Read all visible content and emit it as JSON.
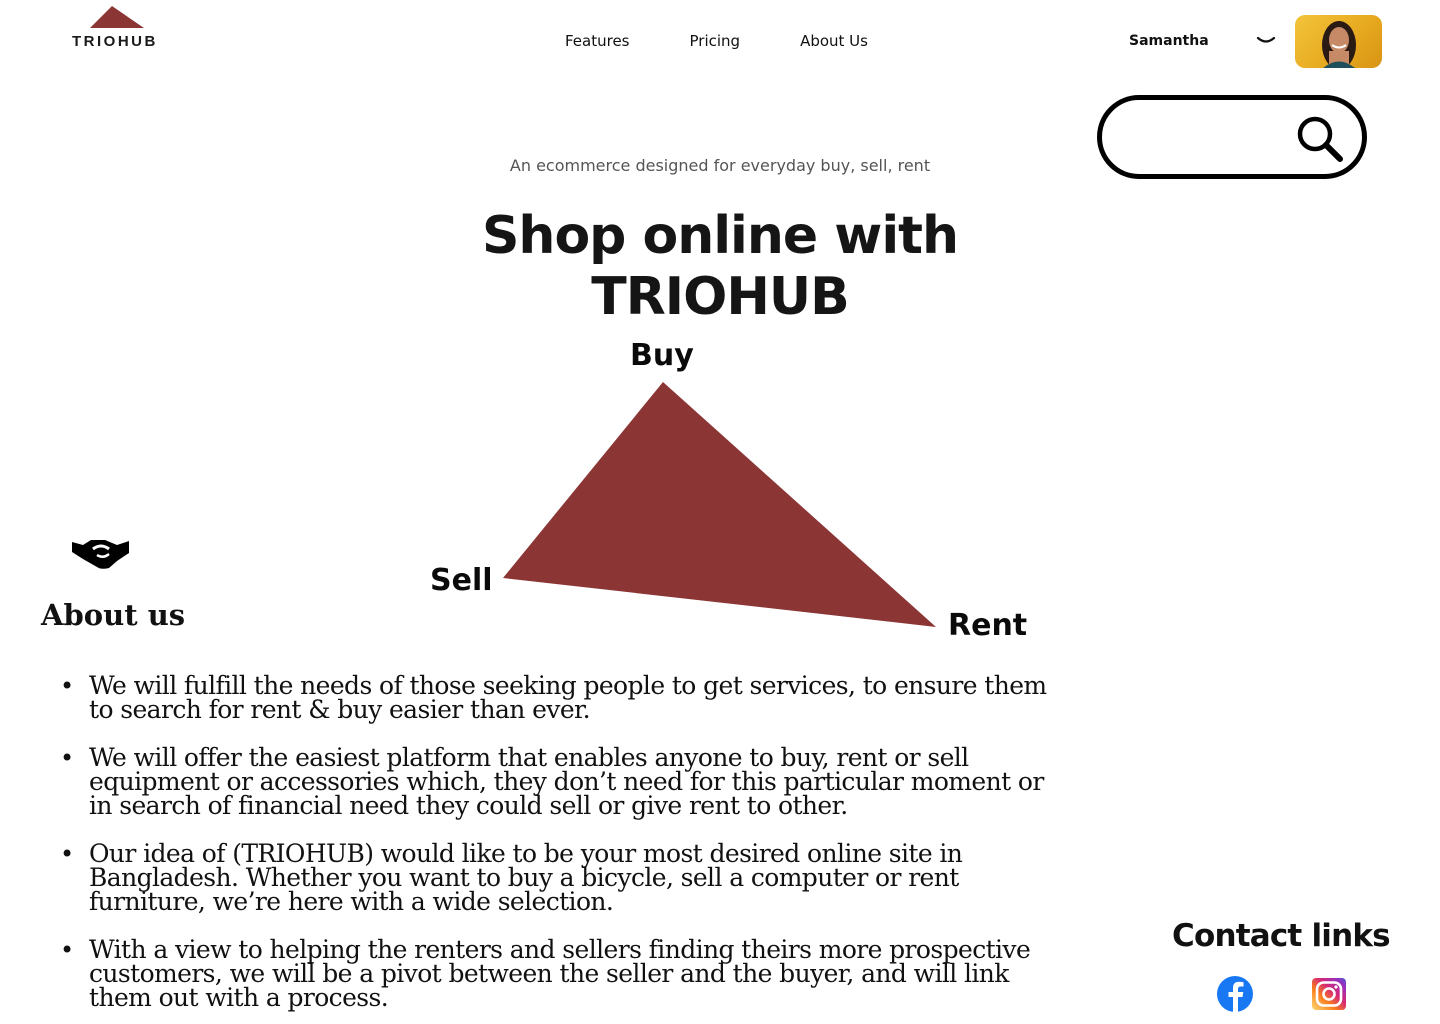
{
  "header": {
    "logo_text": "TRIOHUB",
    "nav": [
      {
        "label": "Features"
      },
      {
        "label": "Pricing"
      },
      {
        "label": "About Us"
      }
    ],
    "user_name": "Samantha",
    "search_placeholder": ""
  },
  "hero": {
    "tagline": "An ecommerce designed for everyday buy, sell, rent",
    "title_line1": "Shop online with",
    "title_line2": "TRIOHUB"
  },
  "diagram": {
    "labels": {
      "top": "Buy",
      "left": "Sell",
      "right": "Rent"
    },
    "color": "#8b3535"
  },
  "about": {
    "heading": "About us",
    "items": [
      "We will fulfill the needs of those seeking people to get services, to ensure them to search for rent & buy easier than ever.",
      "We will offer the easiest platform that enables anyone to buy, rent or sell equipment or accessories which, they don’t need for this particular moment or in search of financial need they could sell or give rent to other.",
      "Our idea of (TRIOHUB) would like to be your most desired online site in Bangladesh. Whether you want to buy a bicycle, sell a computer or rent furniture, we’re here with a wide selection.",
      " With a view to helping the renters and sellers finding theirs more prospective customers, we will be a pivot between the seller and the buyer, and will link them out with a process."
    ]
  },
  "contact": {
    "heading": "Contact links",
    "icons": [
      "facebook-icon",
      "instagram-icon"
    ]
  },
  "colors": {
    "brand": "#8b3535",
    "facebook": "#1877f2"
  }
}
